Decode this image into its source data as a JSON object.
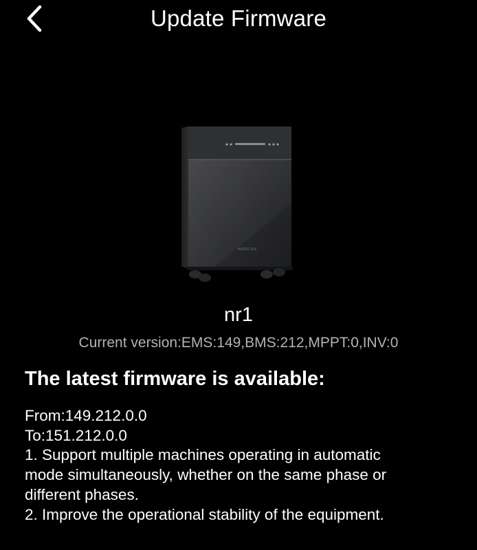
{
  "header": {
    "title": "Update Firmware",
    "back_icon": "chevron-left-icon"
  },
  "device": {
    "image_icon": "battery-inverter-device-image",
    "brand_mark": "MARSTEK",
    "name": "nr1",
    "current_version": "Current version:EMS:149,BMS:212,MPPT:0,INV:0"
  },
  "firmware": {
    "heading": "The latest firmware is available:",
    "from": "From:149.212.0.0",
    "to": "To:151.212.0.0",
    "notes": [
      "1. Support multiple machines operating in automatic",
      "mode simultaneously, whether on the same phase or",
      "different phases.",
      "2. Improve the operational stability of the equipment."
    ]
  },
  "colors": {
    "background": "#000000",
    "text": "#ffffff",
    "secondary_text": "#b3b3b3"
  }
}
